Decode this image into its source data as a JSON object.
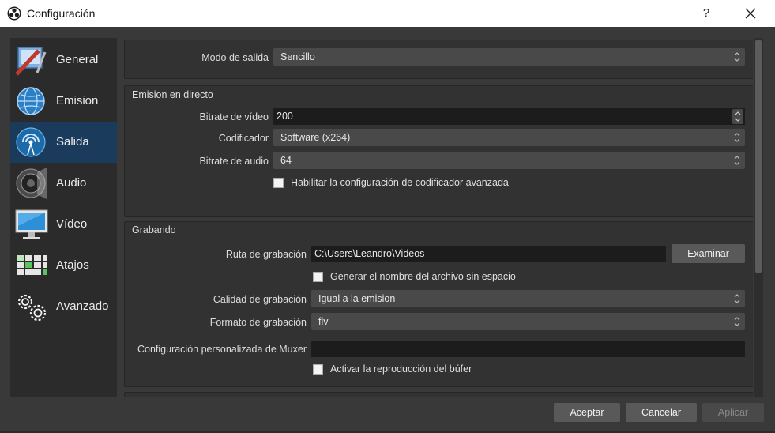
{
  "window": {
    "title": "Configuración",
    "help_label": "?"
  },
  "sidebar": {
    "items": [
      {
        "label": "General",
        "icon": "general-icon"
      },
      {
        "label": "Emision",
        "icon": "globe-icon"
      },
      {
        "label": "Salida",
        "icon": "broadcast-icon",
        "active": true
      },
      {
        "label": "Audio",
        "icon": "speaker-icon"
      },
      {
        "label": "Vídeo",
        "icon": "monitor-icon"
      },
      {
        "label": "Atajos",
        "icon": "keyboard-icon"
      },
      {
        "label": "Avanzado",
        "icon": "gears-icon"
      }
    ]
  },
  "output_mode": {
    "label": "Modo de salida",
    "value": "Sencillo"
  },
  "streaming": {
    "title": "Emision en directo",
    "video_bitrate_label": "Bitrate de vídeo",
    "video_bitrate_value": "200",
    "encoder_label": "Codificador",
    "encoder_value": "Software (x264)",
    "audio_bitrate_label": "Bitrate de audio",
    "audio_bitrate_value": "64",
    "advanced_encoder_label": "Habilitar la configuración de codificador avanzada"
  },
  "recording": {
    "title": "Grabando",
    "path_label": "Ruta de grabación",
    "path_value": "C:\\Users\\Leandro\\Videos",
    "browse_label": "Examinar",
    "no_space_label": "Generar el nombre del archivo sin espacio",
    "quality_label": "Calidad de grabación",
    "quality_value": "Igual a la emision",
    "format_label": "Formato de grabación",
    "format_value": "flv",
    "muxer_label": "Configuración personalizada de Muxer",
    "muxer_value": "",
    "replay_buffer_label": "Activar la reproducción del búfer"
  },
  "footer": {
    "accept_label": "Aceptar",
    "cancel_label": "Cancelar",
    "apply_label": "Aplicar"
  },
  "colors": {
    "background": "#3a393a",
    "sidebar_bg": "#2b2b2b",
    "sidebar_active": "#1a3b5c",
    "input_bg": "#1c1c1c",
    "combo_bg": "#4a494a"
  }
}
